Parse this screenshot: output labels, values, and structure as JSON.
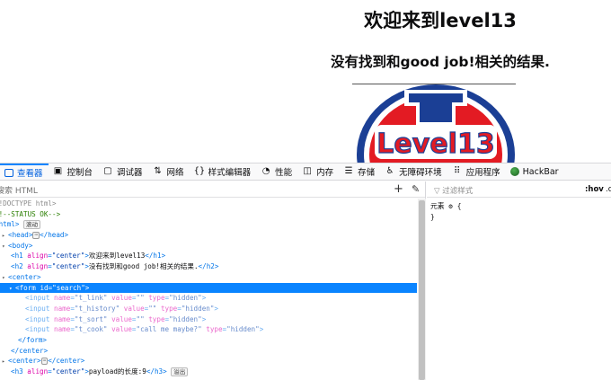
{
  "page": {
    "heading": "欢迎来到level13",
    "subheading": "没有找到和good job!相关的结果.",
    "logo_text": "Level13"
  },
  "devtools": {
    "tabs": [
      {
        "label": "查看器",
        "icon": "inspector-icon"
      },
      {
        "label": "控制台",
        "icon": "console-icon"
      },
      {
        "label": "调试器",
        "icon": "debugger-icon"
      },
      {
        "label": "网络",
        "icon": "network-icon"
      },
      {
        "label": "样式编辑器",
        "icon": "style-editor-icon"
      },
      {
        "label": "性能",
        "icon": "performance-icon"
      },
      {
        "label": "内存",
        "icon": "memory-icon"
      },
      {
        "label": "存储",
        "icon": "storage-icon"
      },
      {
        "label": "无障碍环境",
        "icon": "accessibility-icon"
      },
      {
        "label": "应用程序",
        "icon": "application-icon"
      },
      {
        "label": "HackBar",
        "icon": "hackbar-icon"
      }
    ],
    "search_placeholder": "搜索 HTML",
    "filter_placeholder": "过滤样式",
    "hov": ":hov",
    "cls": ".c",
    "rules": {
      "element_label": "元素",
      "open_brace": "{",
      "close_brace": "}"
    },
    "tree": {
      "doctype": "<!DOCTYPE html>",
      "comment": "<!--STATUS OK-->",
      "html_open": "<html>",
      "scroll_badge": "滚动",
      "head": "<head>",
      "head_close": "</head>",
      "body_open": "<body>",
      "h1_text": "欢迎来到level13",
      "h2_text": "没有找到和good job!相关的结果.",
      "center_open": "<center>",
      "form_id": "search",
      "inputs": [
        {
          "name": "t_link",
          "value": "",
          "type": "hidden"
        },
        {
          "name": "t_history",
          "value": "",
          "type": "hidden"
        },
        {
          "name": "t_sort",
          "value": "",
          "type": "hidden"
        },
        {
          "name": "t_cook",
          "value": "call me maybe?",
          "type": "hidden"
        }
      ],
      "form_close": "</form>",
      "center_close": "</center>",
      "collapsed_center_open": "<center>",
      "collapsed_center_close": "</center>",
      "h3_text": "payload的长度:9",
      "overflow_badge": "溢出"
    }
  }
}
